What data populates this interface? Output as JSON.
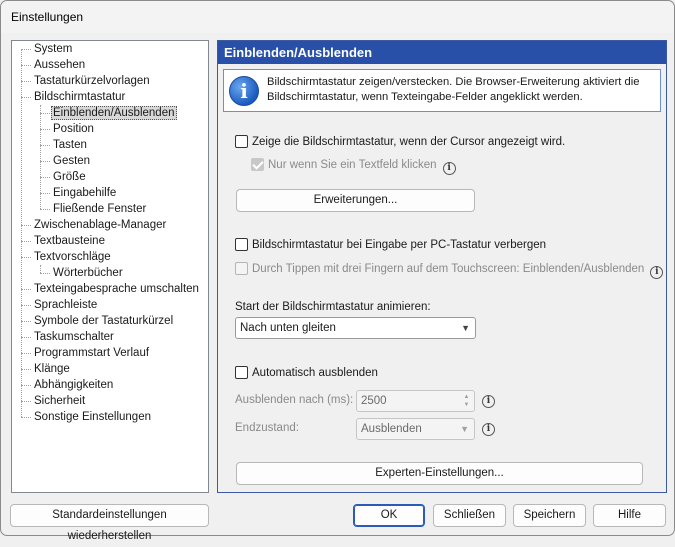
{
  "window": {
    "title": "Einstellungen"
  },
  "tree": {
    "items": [
      {
        "label": "System"
      },
      {
        "label": "Aussehen"
      },
      {
        "label": "Tastaturkürzelvorlagen"
      },
      {
        "label": "Bildschirmtastatur"
      },
      {
        "label": "Einblenden/Ausblenden",
        "selected": true
      },
      {
        "label": "Position"
      },
      {
        "label": "Tasten"
      },
      {
        "label": "Gesten"
      },
      {
        "label": "Größe"
      },
      {
        "label": "Eingabehilfe"
      },
      {
        "label": "Fließende Fenster"
      },
      {
        "label": "Zwischenablage-Manager"
      },
      {
        "label": "Textbausteine"
      },
      {
        "label": "Textvorschläge"
      },
      {
        "label": "Wörterbücher"
      },
      {
        "label": "Texteingabesprache umschalten"
      },
      {
        "label": "Sprachleiste"
      },
      {
        "label": "Symbole der Tastaturkürzel"
      },
      {
        "label": "Taskumschalter"
      },
      {
        "label": "Programmstart Verlauf"
      },
      {
        "label": "Klänge"
      },
      {
        "label": "Abhängigkeiten"
      },
      {
        "label": "Sicherheit"
      },
      {
        "label": "Sonstige Einstellungen"
      }
    ]
  },
  "panel": {
    "header": "Einblenden/Ausblenden",
    "info_line1": "Bildschirmtastatur zeigen/verstecken. Die Browser-Erweiterung aktiviert die",
    "info_line2": "Bildschirmtastatur, wenn Texteingabe-Felder angeklickt werden.",
    "show_when_cursor": "Zeige die Bildschirmtastatur, wenn der Cursor angezeigt wird.",
    "only_textfield": "Nur wenn Sie ein Textfeld klicken",
    "extensions_button": "Erweiterungen...",
    "hide_on_pc_keyboard": "Bildschirmtastatur bei Eingabe per PC-Tastatur verbergen",
    "three_finger_tap": "Durch Tippen mit drei Fingern auf dem Touchscreen: Einblenden/Ausblenden",
    "animate_label": "Start der Bildschirmtastatur animieren:",
    "animate_value": "Nach unten gleiten",
    "auto_hide": "Automatisch ausblenden",
    "hide_after_label": "Ausblenden nach (ms):",
    "hide_after_value": "2500",
    "end_state_label": "Endzustand:",
    "end_state_value": "Ausblenden",
    "expert_button": "Experten-Einstellungen..."
  },
  "footer": {
    "restore_defaults": "Standardeinstellungen wiederherstellen",
    "ok": "OK",
    "close": "Schließen",
    "save": "Speichern",
    "help": "Hilfe"
  },
  "colors": {
    "header_bg": "#2850a8",
    "accent_border": "#2a5bb8"
  }
}
